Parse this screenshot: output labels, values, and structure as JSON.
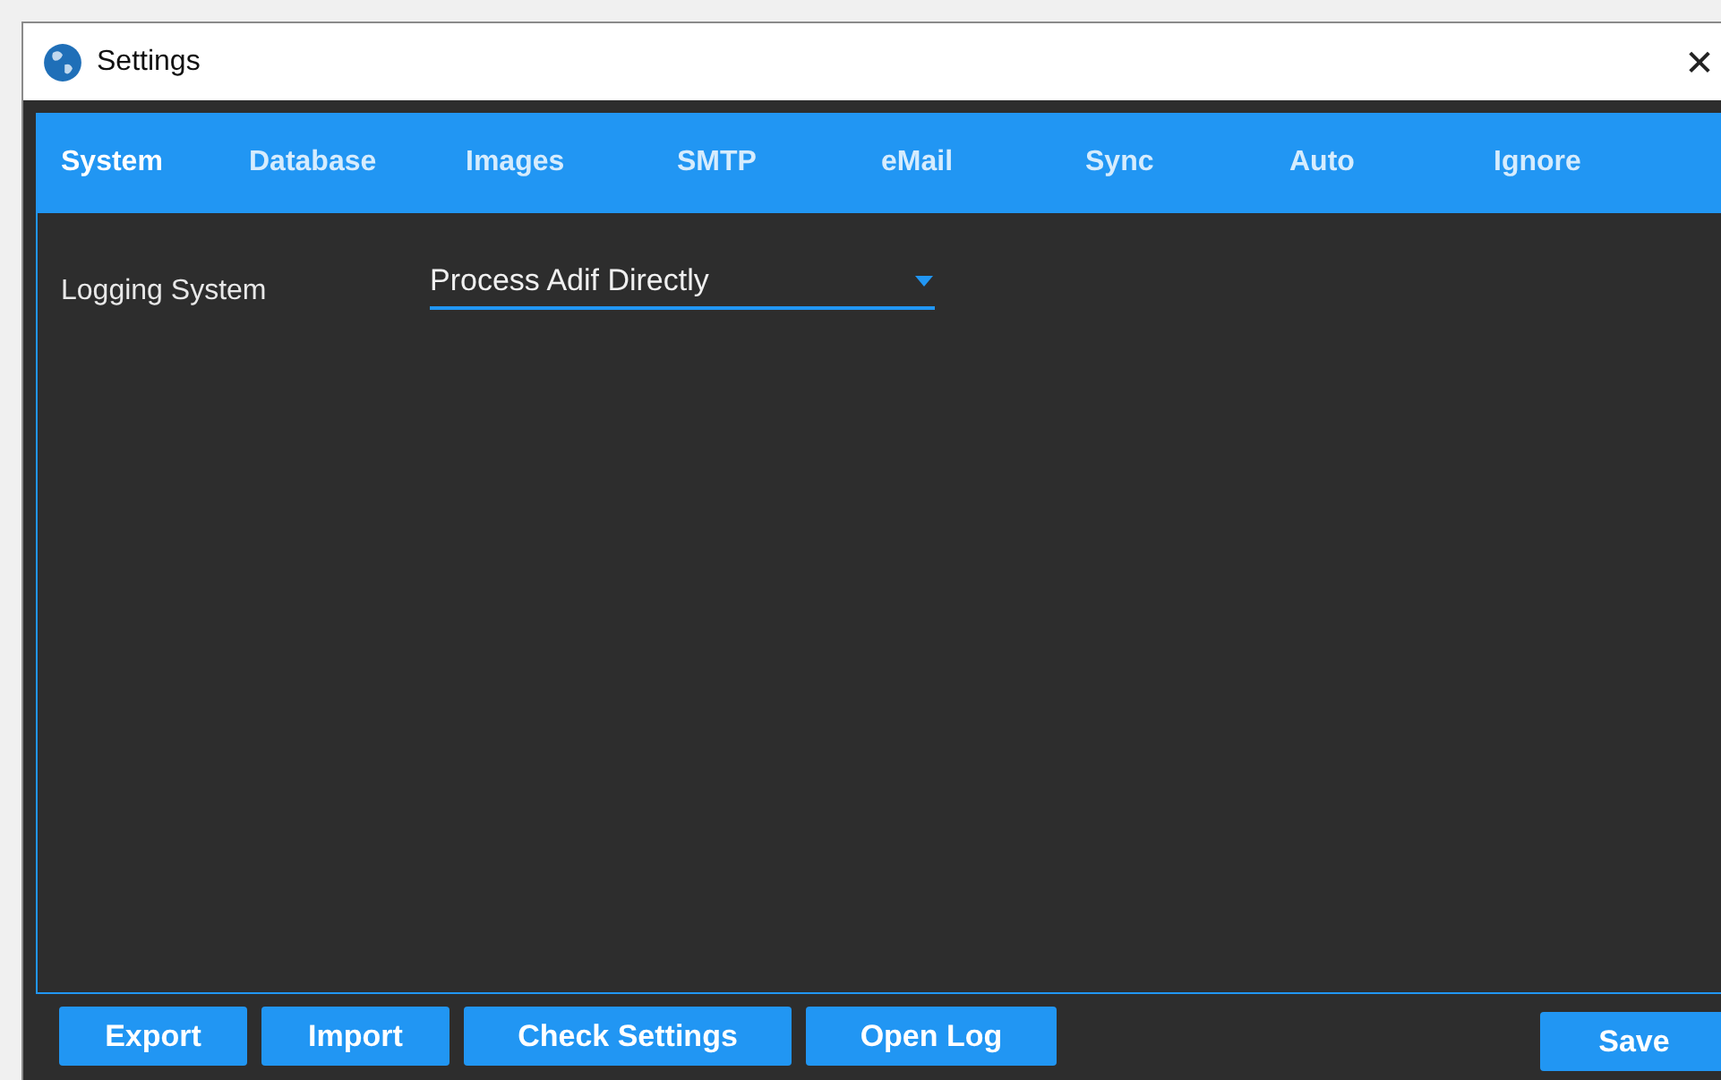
{
  "window": {
    "title": "Settings",
    "close": "✕"
  },
  "tabs": [
    {
      "label": "System",
      "selected": true
    },
    {
      "label": "Database",
      "selected": false
    },
    {
      "label": "Images",
      "selected": false
    },
    {
      "label": "SMTP",
      "selected": false
    },
    {
      "label": "eMail",
      "selected": false
    },
    {
      "label": "Sync",
      "selected": false
    },
    {
      "label": "Auto",
      "selected": false
    },
    {
      "label": "Ignore",
      "selected": false
    }
  ],
  "fields": [
    {
      "label": "Logging System",
      "value": "Process Adif Directly"
    }
  ],
  "buttons": [
    "Export",
    "Import",
    "Check Settings",
    "Open Log"
  ],
  "save_button": "Save"
}
